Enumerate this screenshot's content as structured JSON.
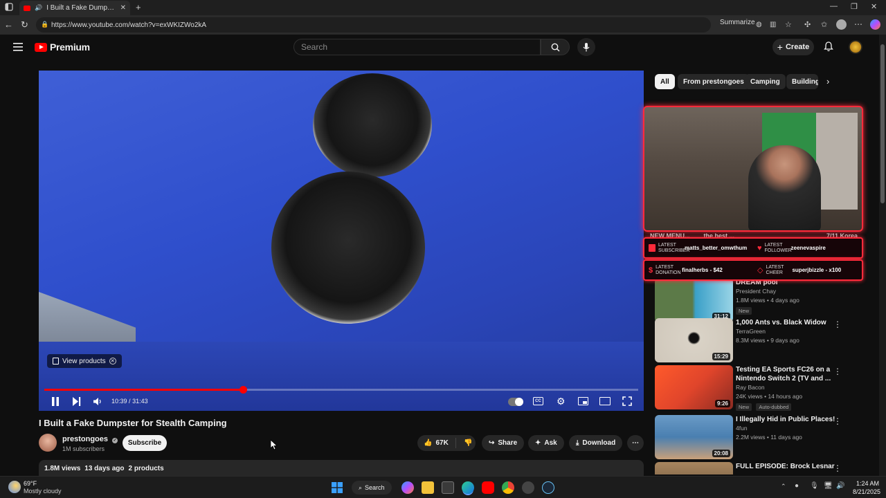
{
  "browser": {
    "tab_title": "I Built a Fake Dumpster for S",
    "url": "https://www.youtube.com/watch?v=exWKIZWo2kA",
    "summarize_label": "Summarize"
  },
  "header": {
    "brand": "Premium",
    "search_placeholder": "Search",
    "create_label": "Create"
  },
  "player": {
    "view_products_label": "View products",
    "time_current": "10:39",
    "time_separator": "/",
    "time_total": "31:43",
    "progress_fraction": 0.335
  },
  "video": {
    "title": "I Built a Fake Dumpster for Stealth Camping",
    "channel": "prestongoes",
    "subscribers": "1M subscribers",
    "subscribe_label": "Subscribe",
    "likes": "67K",
    "share_label": "Share",
    "ask_label": "Ask",
    "download_label": "Download",
    "views": "1.8M views",
    "age": "13 days ago",
    "products": "2 products"
  },
  "chips": [
    "All",
    "From prestongoes",
    "Camping",
    "Building"
  ],
  "stream_overlay": {
    "ticker": [
      "NEW MENU...",
      "the best ...",
      "7/11 Korea"
    ],
    "alerts": [
      {
        "label_a": "LATEST SUBSCRIBER",
        "value_a": "matts_better_omwthum",
        "label_b": "LATEST FOLLOWER",
        "value_b": "zeenevaspire"
      },
      {
        "label_a": "LATEST DONATION",
        "value_a": "finalherbs - $42",
        "label_b": "LATEST CHEER",
        "value_b": "superjbizzle - x100"
      }
    ]
  },
  "recommendations": [
    {
      "title": "DREAM pool",
      "channel": "President Chay",
      "meta": "1.8M views • 4 days ago",
      "badges": [
        "New"
      ],
      "duration": "31:12",
      "thumb_color": "#3aa0c8"
    },
    {
      "title": "1,000 Ants vs. Black Widow",
      "channel": "TerraGreen",
      "meta": "8.3M views • 9 days ago",
      "badges": [],
      "duration": "15:29",
      "thumb_color": "#d9d2c6"
    },
    {
      "title": "Testing EA Sports FC26 on a Nintendo Switch 2 (TV and ...",
      "channel": "Ray Bacon",
      "meta": "24K views • 14 hours ago",
      "badges": [
        "New",
        "Auto-dubbed"
      ],
      "duration": "9:26",
      "thumb_color": "#e0452b"
    },
    {
      "title": "I Illegally Hid in Public Places!",
      "channel": "4fun",
      "meta": "2.2M views • 11 days ago",
      "badges": [],
      "duration": "20:08",
      "thumb_color": "#4a7fb0"
    },
    {
      "title": "FULL EPISODE: Brock Lesnar –",
      "channel": "",
      "meta": "",
      "badges": [],
      "duration": "",
      "thumb_color": "#8a6a4a"
    }
  ],
  "taskbar": {
    "weather_temp": "69°F",
    "weather_desc": "Mostly cloudy",
    "search_label": "Search",
    "time": "1:24 AM",
    "date": "8/21/2025"
  },
  "colors": {
    "accent_red": "#ff0000",
    "overlay_red": "#ff2a3a",
    "background": "#0f0f0f"
  }
}
